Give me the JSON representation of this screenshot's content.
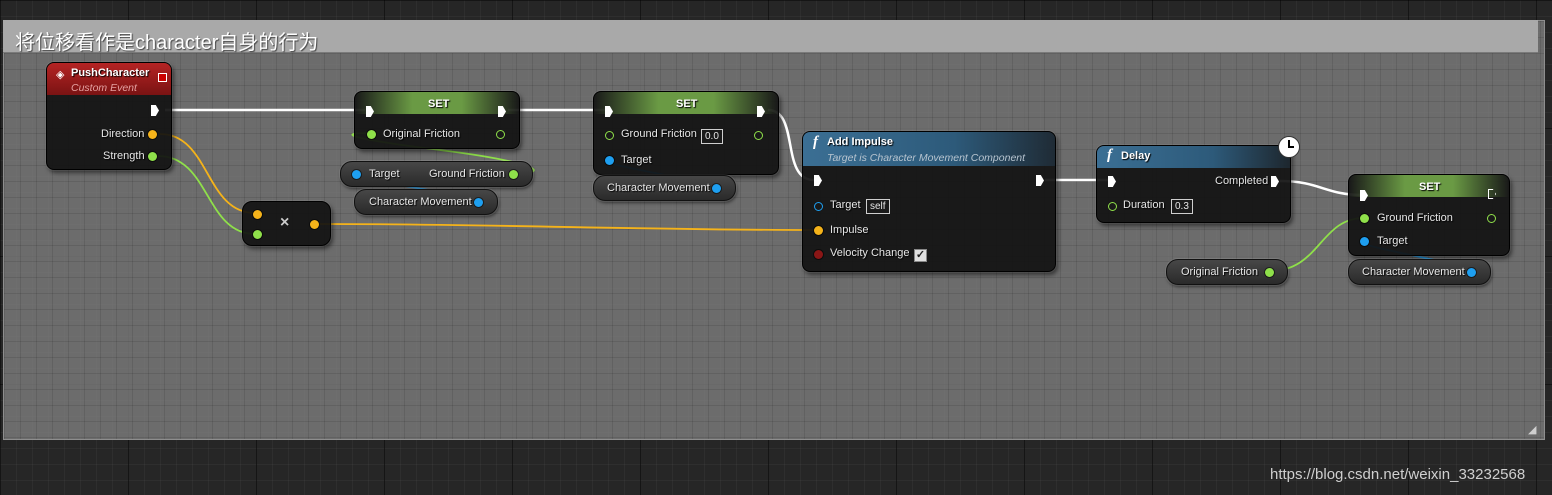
{
  "comment": {
    "title": "将位移看作是character自身的行为"
  },
  "watermark": "https://blog.csdn.net/weixin_33232568",
  "colors": {
    "exec": "#ffffff",
    "vector": "#f5b31a",
    "float": "#8fe04a",
    "object": "#1e9ff0",
    "bool": "#8a1616",
    "set_header": "#6a9a44",
    "event_header": "#9b1b1b",
    "function_header": "#2d5a7a"
  },
  "event_node": {
    "title": "PushCharacter",
    "subtitle": "Custom Event",
    "icon": "event-diamond-icon",
    "outputs": [
      "Direction",
      "Strength"
    ]
  },
  "multiply_node": {
    "symbol": "×"
  },
  "set_node_1": {
    "title": "SET",
    "variable": "Original Friction"
  },
  "get_node_1": {
    "target_label": "Target",
    "output_label": "Ground Friction"
  },
  "char_movement_1": {
    "label": "Character Movement"
  },
  "set_node_2": {
    "title": "SET",
    "variable": "Ground Friction",
    "value": "0.0",
    "target_label": "Target"
  },
  "char_movement_2": {
    "label": "Character Movement"
  },
  "add_impulse_node": {
    "title": "Add Impulse",
    "subtitle": "Target is Character Movement Component",
    "icon": "function-f-icon",
    "target_label": "Target",
    "target_value": "self",
    "impulse_label": "Impulse",
    "velocity_change_label": "Velocity Change",
    "velocity_change_checked": true
  },
  "delay_node": {
    "title": "Delay",
    "icon": "function-f-icon",
    "completed_label": "Completed",
    "duration_label": "Duration",
    "duration_value": "0.3",
    "latent_icon": "clock-icon"
  },
  "original_friction_get": {
    "label": "Original Friction"
  },
  "set_node_3": {
    "title": "SET",
    "variable": "Ground Friction",
    "target_label": "Target"
  },
  "char_movement_3": {
    "label": "Character Movement"
  }
}
